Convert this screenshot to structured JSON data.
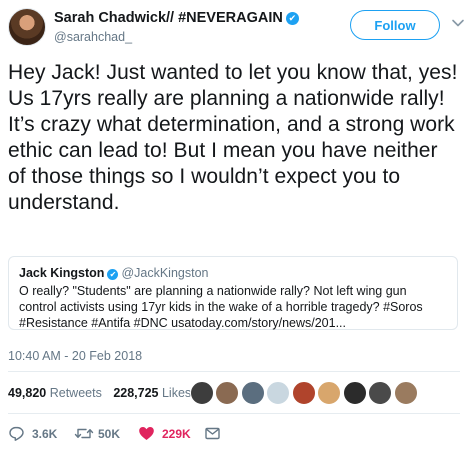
{
  "author": {
    "display_name": "Sarah Chadwick// #NEVERAGAIN",
    "handle": "@sarahchad_",
    "verified_mark": "✔"
  },
  "follow_label": "Follow",
  "tweet_text": "Hey Jack! Just wanted to let you know that, yes! Us 17yrs really are planning a nationwide rally! It’s crazy what determination, and a strong work ethic can lead to! But I mean you have neither of those things so I wouldn’t expect you to understand.",
  "quoted": {
    "display_name": "Jack Kingston",
    "handle": "@JackKingston",
    "text": "O really? \"Students\" are planning a nationwide rally? Not left wing gun control activists using 17yr kids in the wake of a horrible tragedy? #Soros #Resistance #Antifa #DNC  usatoday.com/story/news/201..."
  },
  "timestamp": "10:40 AM - 20 Feb 2018",
  "stats": {
    "retweets_count": "49,820",
    "retweets_label": "Retweets",
    "likes_count": "228,725",
    "likes_label": "Likes"
  },
  "actions": {
    "replies": "3.6K",
    "retweets": "50K",
    "likes": "229K"
  },
  "colors": {
    "accent": "#1da1f2",
    "like": "#e0245e",
    "muted": "#657786"
  },
  "icons": [
    "chevron-down-icon",
    "verified-icon",
    "reply-icon",
    "retweet-icon",
    "heart-icon",
    "message-icon"
  ]
}
